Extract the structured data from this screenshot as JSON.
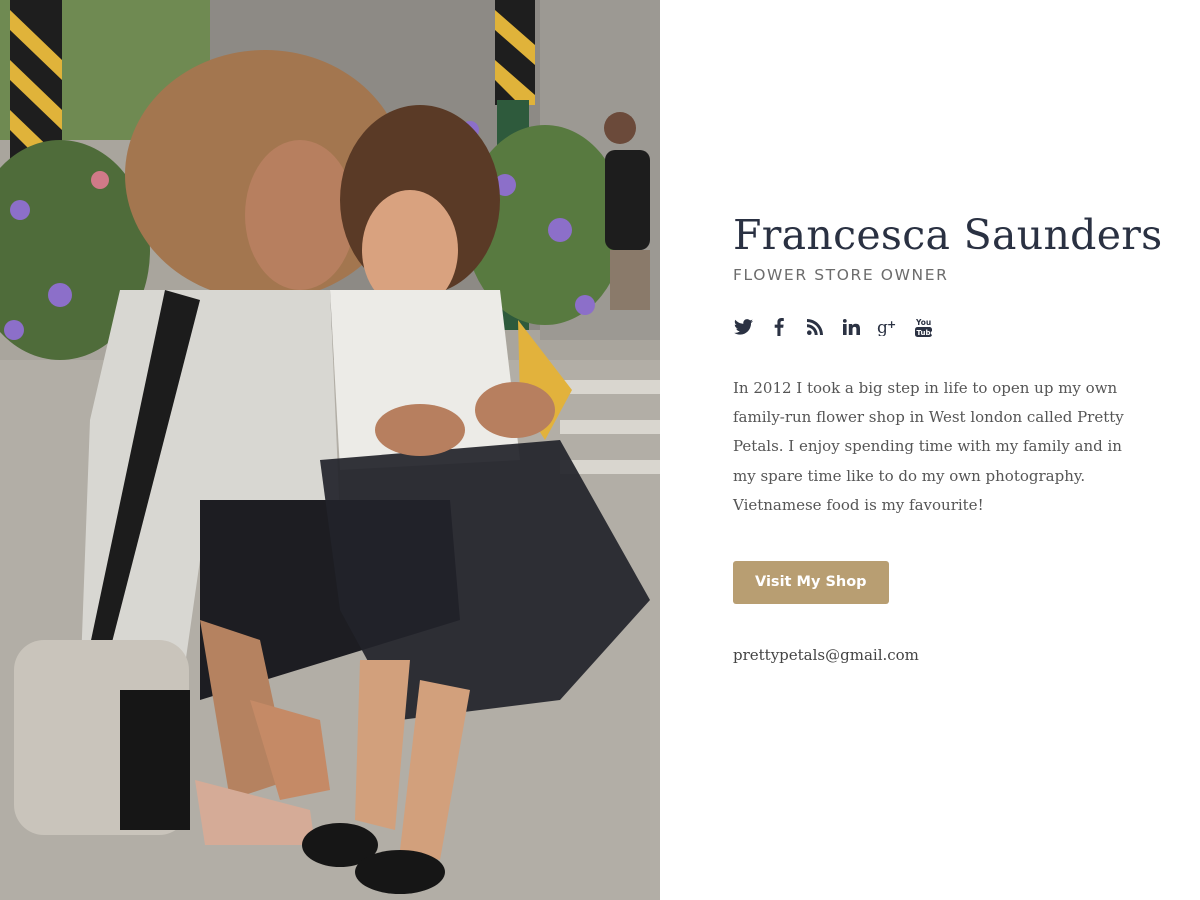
{
  "profile": {
    "name": "Francesca Saunders",
    "role": "FLOWER STORE OWNER",
    "bio": "In 2012 I took a big step in life to open up my own family-run flower shop in West london called Pretty Petals. I enjoy spending time with my family and in my spare time like to do my own photography. Vietnamese food is my favourite!",
    "cta_label": "Visit My Shop",
    "email": "prettypetals@gmail.com"
  },
  "socials": [
    {
      "icon": "twitter-icon"
    },
    {
      "icon": "facebook-icon"
    },
    {
      "icon": "rss-icon"
    },
    {
      "icon": "linkedin-icon"
    },
    {
      "icon": "google-plus-icon"
    },
    {
      "icon": "youtube-icon"
    }
  ],
  "colors": {
    "heading": "#2a3142",
    "accent_button": "#b89e72",
    "body_text": "#555555"
  }
}
